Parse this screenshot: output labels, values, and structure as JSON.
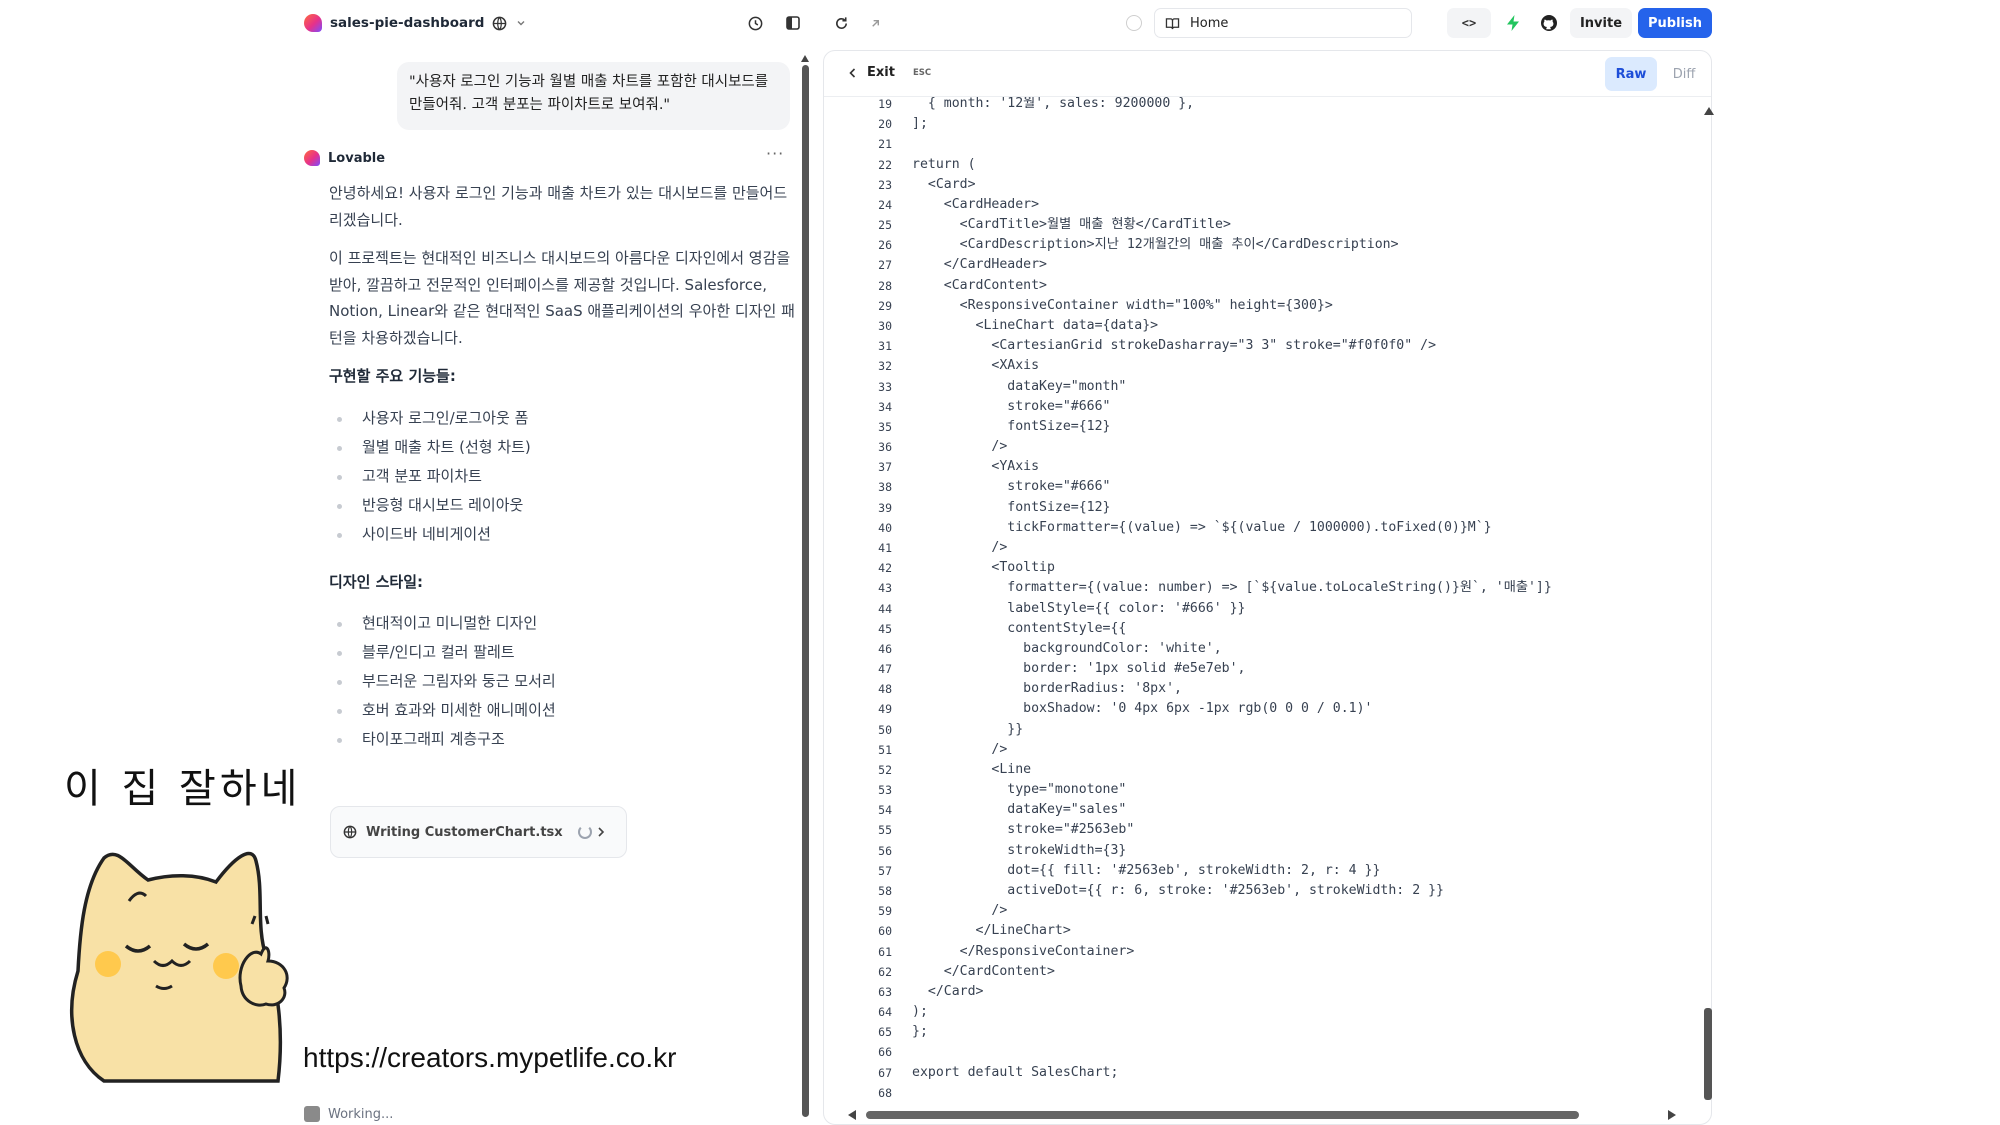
{
  "topbar": {
    "project_name": "sales-pie-dashboard",
    "url_text": "Home",
    "code_toggle": "<>",
    "invite_label": "Invite",
    "publish_label": "Publish",
    "accent": "#2563eb"
  },
  "chat": {
    "user_message": "\"사용자 로그인 기능과 월별 매출 차트를 포함한 대시보드를 만들어줘. 고객 분포는 파이차트로 보여줘.\"",
    "ai_name": "Lovable",
    "more_label": "···",
    "paragraphs": [
      "안녕하세요! 사용자 로그인 기능과 매출 차트가 있는 대시보드를 만들어드리겠습니다.",
      "이 프로젝트는 현대적인 비즈니스 대시보드의 아름다운 디자인에서 영감을 받아, 깔끔하고 전문적인 인터페이스를 제공할 것입니다. Salesforce, Notion, Linear와 같은 현대적인 SaaS 애플리케이션의 우아한 디자인 패턴을 차용하겠습니다."
    ],
    "features_heading": "구현할 주요 기능들:",
    "features": [
      "사용자 로그인/로그아웃 폼",
      "월별 매출 차트 (선형 차트)",
      "고객 분포 파이차트",
      "반응형 대시보드 레이아웃",
      "사이드바 네비게이션"
    ],
    "design_heading": "디자인 스타일:",
    "design_items": [
      "현대적이고 미니멀한 디자인",
      "블루/인디고 컬러 팔레트",
      "부드러운 그림자와 둥근 모서리",
      "호버 효과와 미세한 애니메이션",
      "타이포그래피 계층구조"
    ],
    "tool_chip_label": "Writing CustomerChart.tsx",
    "working_label": "Working..."
  },
  "overlay": {
    "caption": "이 집 잘하네",
    "url": "https://creators.mypetlife.co.kr"
  },
  "code_panel": {
    "exit_label": "Exit",
    "esc_label": "ESC",
    "raw_label": "Raw",
    "diff_label": "Diff",
    "lines": [
      {
        "n": "19",
        "code": "  { month: '12월', sales: 9200000 },"
      },
      {
        "n": "20",
        "code": "];"
      },
      {
        "n": "21",
        "code": ""
      },
      {
        "n": "22",
        "code": "return ("
      },
      {
        "n": "23",
        "code": "  <Card>"
      },
      {
        "n": "24",
        "code": "    <CardHeader>"
      },
      {
        "n": "25",
        "code": "      <CardTitle>월별 매출 현황</CardTitle>"
      },
      {
        "n": "26",
        "code": "      <CardDescription>지난 12개월간의 매출 추이</CardDescription>"
      },
      {
        "n": "27",
        "code": "    </CardHeader>"
      },
      {
        "n": "28",
        "code": "    <CardContent>"
      },
      {
        "n": "29",
        "code": "      <ResponsiveContainer width=\"100%\" height={300}>"
      },
      {
        "n": "30",
        "code": "        <LineChart data={data}>"
      },
      {
        "n": "31",
        "code": "          <CartesianGrid strokeDasharray=\"3 3\" stroke=\"#f0f0f0\" />"
      },
      {
        "n": "32",
        "code": "          <XAxis"
      },
      {
        "n": "33",
        "code": "            dataKey=\"month\""
      },
      {
        "n": "34",
        "code": "            stroke=\"#666\""
      },
      {
        "n": "35",
        "code": "            fontSize={12}"
      },
      {
        "n": "36",
        "code": "          />"
      },
      {
        "n": "37",
        "code": "          <YAxis"
      },
      {
        "n": "38",
        "code": "            stroke=\"#666\""
      },
      {
        "n": "39",
        "code": "            fontSize={12}"
      },
      {
        "n": "40",
        "code": "            tickFormatter={(value) => `${(value / 1000000).toFixed(0)}M`}"
      },
      {
        "n": "41",
        "code": "          />"
      },
      {
        "n": "42",
        "code": "          <Tooltip"
      },
      {
        "n": "43",
        "code": "            formatter={(value: number) => [`${value.toLocaleString()}원`, '매출']}"
      },
      {
        "n": "44",
        "code": "            labelStyle={{ color: '#666' }}"
      },
      {
        "n": "45",
        "code": "            contentStyle={{"
      },
      {
        "n": "46",
        "code": "              backgroundColor: 'white',"
      },
      {
        "n": "47",
        "code": "              border: '1px solid #e5e7eb',"
      },
      {
        "n": "48",
        "code": "              borderRadius: '8px',"
      },
      {
        "n": "49",
        "code": "              boxShadow: '0 4px 6px -1px rgb(0 0 0 / 0.1)'"
      },
      {
        "n": "50",
        "code": "            }}"
      },
      {
        "n": "51",
        "code": "          />"
      },
      {
        "n": "52",
        "code": "          <Line"
      },
      {
        "n": "53",
        "code": "            type=\"monotone\""
      },
      {
        "n": "54",
        "code": "            dataKey=\"sales\""
      },
      {
        "n": "55",
        "code": "            stroke=\"#2563eb\""
      },
      {
        "n": "56",
        "code": "            strokeWidth={3}"
      },
      {
        "n": "57",
        "code": "            dot={{ fill: '#2563eb', strokeWidth: 2, r: 4 }}"
      },
      {
        "n": "58",
        "code": "            activeDot={{ r: 6, stroke: '#2563eb', strokeWidth: 2 }}"
      },
      {
        "n": "59",
        "code": "          />"
      },
      {
        "n": "60",
        "code": "        </LineChart>"
      },
      {
        "n": "61",
        "code": "      </ResponsiveContainer>"
      },
      {
        "n": "62",
        "code": "    </CardContent>"
      },
      {
        "n": "63",
        "code": "  </Card>"
      },
      {
        "n": "64",
        "code": ");"
      },
      {
        "n": "65",
        "code": "};"
      },
      {
        "n": "66",
        "code": ""
      },
      {
        "n": "67",
        "code": "export default SalesChart;"
      },
      {
        "n": "68",
        "code": ""
      }
    ]
  }
}
